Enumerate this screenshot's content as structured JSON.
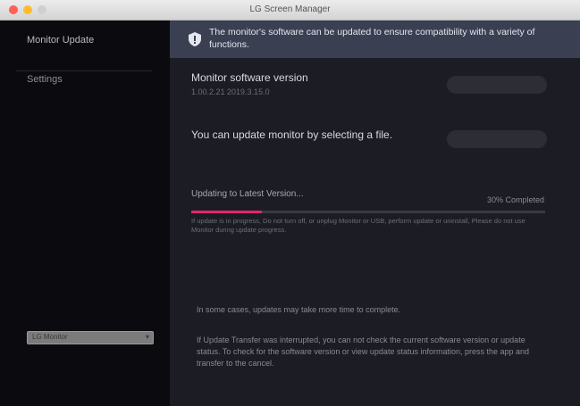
{
  "window": {
    "title": "LG Screen Manager"
  },
  "sidebar": {
    "items": [
      {
        "label": "Monitor Update"
      },
      {
        "label": "Settings"
      }
    ],
    "selector": {
      "value": "LG Monitor"
    }
  },
  "banner": {
    "text": "The monitor's software can be updated to ensure compatibility with a variety of functions."
  },
  "software": {
    "title": "Monitor software version",
    "version": "1.00.2.21 2019.3.15.0"
  },
  "file_update": {
    "title": "You can update monitor by selecting a file."
  },
  "progress": {
    "label": "Updating to Latest Version...",
    "percent_text": "30% Completed",
    "value": 0.2,
    "warning": "If update is in progress, Do not turn off, or unplug Monitor or USB, perform update or uninstall, Please do not use Monitor during update progress."
  },
  "notes": [
    "In some cases, updates may take more time to complete.",
    "If Update Transfer was interrupted, you can not check the current software version or update status. To check for the software version or view update status information, press the app and transfer to the cancel."
  ],
  "colors": {
    "accent": "#e0286b",
    "banner": "#3a4052",
    "sidebar": "#0b0b0f",
    "content": "#1c1c24"
  }
}
